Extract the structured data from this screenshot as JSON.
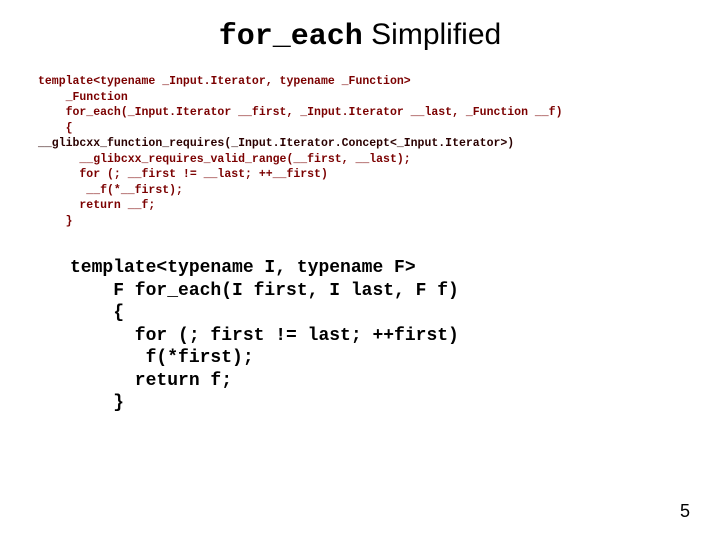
{
  "title": {
    "mono": "for_each",
    "rest": " Simplified"
  },
  "code1": {
    "l1": "template<typename _Input.Iterator, typename _Function>",
    "l2": "    _Function",
    "l3": "    for_each(_Input.Iterator __first, _Input.Iterator __last, _Function __f)",
    "l4": "    {",
    "l5": "__glibcxx_function_requires(_Input.Iterator.Concept<_Input.Iterator>)",
    "l6": "      __glibcxx_requires_valid_range(__first, __last);",
    "l7": "      for (; __first != __last; ++__first)",
    "l8": "       __f(*__first);",
    "l9": "      return __f;",
    "l10": "    }"
  },
  "code2": {
    "l1": "template<typename I, typename F>",
    "l2": "    F for_each(I first, I last, F f)",
    "l3": "    {",
    "l4": "      for (; first != last; ++first)",
    "l5": "       f(*first);",
    "l6": "      return f;",
    "l7": "    }"
  },
  "page_number": "5"
}
